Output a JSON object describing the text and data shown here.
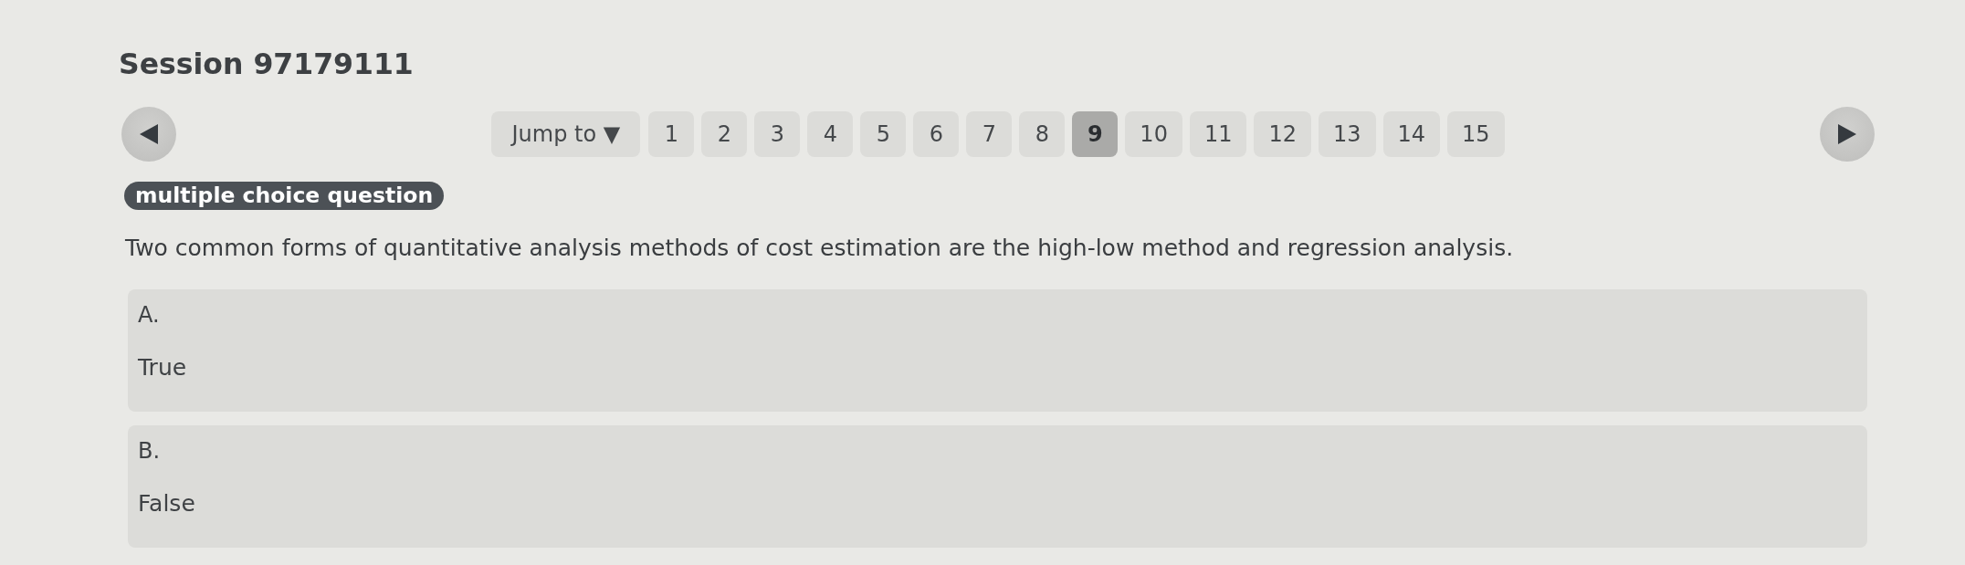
{
  "session_title": "Session 97179111",
  "pager": {
    "jump_to": "Jump to ▼",
    "pages": [
      {
        "label": "1",
        "selected": false
      },
      {
        "label": "2",
        "selected": false
      },
      {
        "label": "3",
        "selected": false
      },
      {
        "label": "4",
        "selected": false
      },
      {
        "label": "5",
        "selected": false
      },
      {
        "label": "6",
        "selected": false
      },
      {
        "label": "7",
        "selected": false
      },
      {
        "label": "8",
        "selected": false
      },
      {
        "label": "9",
        "selected": true
      },
      {
        "label": "10",
        "selected": false
      },
      {
        "label": "11",
        "selected": false
      },
      {
        "label": "12",
        "selected": false
      },
      {
        "label": "13",
        "selected": false
      },
      {
        "label": "14",
        "selected": false
      },
      {
        "label": "15",
        "selected": false
      }
    ]
  },
  "question": {
    "type_badge": "multiple choice question",
    "text": "Two common forms of quantitative analysis methods of cost estimation are the high-low method and regression analysis.",
    "options": [
      {
        "letter": "A.",
        "text": "True",
        "selected": false
      },
      {
        "letter": "B.",
        "text": "False",
        "selected": false
      }
    ]
  }
}
